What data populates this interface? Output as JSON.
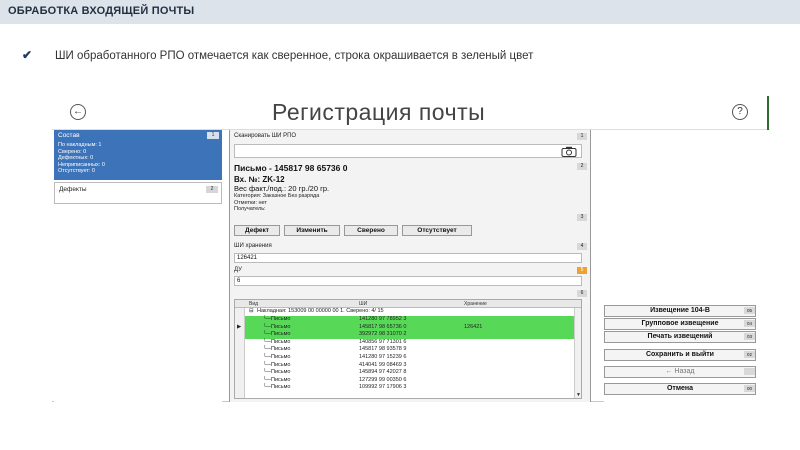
{
  "slide": {
    "header": "ОБРАБОТКА ВХОДЯЩЕЙ ПОЧТЫ",
    "bullet_mark": "✔",
    "bullet_text": "ШИ обработанного РПО отмечается как сверенное, строка окрашивается в зеленый цвет"
  },
  "app": {
    "title": "Регистрация почты",
    "back_glyph": "←",
    "help_glyph": "?",
    "sostav": {
      "title": "Состав",
      "badge": "1",
      "lines": [
        "По накладным: 1",
        "Сверено: 0",
        "Дефектных: 0",
        "Неприписанных: 0",
        "Отсутствует: 0"
      ]
    },
    "defects": {
      "title": "Дефекты",
      "badge": "2"
    },
    "scan": {
      "label": "Сканировать ШИ РПО",
      "badge": "1"
    },
    "item": {
      "badge": "2",
      "title": "Письмо - 145817 98 65736 0",
      "vx": "Вх. №: ZK-12",
      "weight": "Вес факт./под.: 20 гр./20 гр.",
      "lines": [
        "Категория: Заказное Без разряда",
        "Отметки: нет",
        "Получатель:"
      ]
    },
    "actions_badge": "3",
    "actions": [
      "Дефект",
      "Изменить",
      "Сверено",
      "Отсутствует"
    ],
    "storage": {
      "label": "ШИ хранения",
      "badge": "4",
      "value": "126421"
    },
    "du": {
      "label": "ДУ",
      "badge": "5",
      "value": "6"
    },
    "grid_badge": "6",
    "grid": {
      "columns": [
        "Вид",
        "ШИ",
        "Хранение"
      ],
      "group": "Накладная: 153009 00 00000 00 1. Сверено: 4/ 15",
      "rows": [
        {
          "type": "Письмо",
          "id": "141280 97 78952 3",
          "storage": "",
          "green": true,
          "current": false
        },
        {
          "type": "Письмо",
          "id": "145817 98 65736 0",
          "storage": "126421",
          "green": true,
          "current": true
        },
        {
          "type": "Письмо",
          "id": "392972 98 31070 2",
          "storage": "",
          "green": true,
          "current": false
        },
        {
          "type": "Письмо",
          "id": "140856 97 71301 6",
          "storage": "",
          "green": false,
          "current": false
        },
        {
          "type": "Письмо",
          "id": "145817 98 93578 9",
          "storage": "",
          "green": false,
          "current": false
        },
        {
          "type": "Письмо",
          "id": "141280 97 15239 6",
          "storage": "",
          "green": false,
          "current": false
        },
        {
          "type": "Письмо",
          "id": "414041 99 08469 3",
          "storage": "",
          "green": false,
          "current": false
        },
        {
          "type": "Письмо",
          "id": "145894 97 42027 8",
          "storage": "",
          "green": false,
          "current": false
        },
        {
          "type": "Письмо",
          "id": "127299 99 00350 6",
          "storage": "",
          "green": false,
          "current": false
        },
        {
          "type": "Письмо",
          "id": "109992 97 17906 3",
          "storage": "",
          "green": false,
          "current": false
        }
      ]
    },
    "side_buttons": [
      {
        "label": "Извещение 104-В",
        "badge": "05",
        "disabled": false
      },
      {
        "label": "Групповое извещение",
        "badge": "04",
        "disabled": false
      },
      {
        "label": "Печать извещений",
        "badge": "03",
        "disabled": false
      },
      {
        "label": "Сохранить и выйти",
        "badge": "02",
        "disabled": false
      },
      {
        "label": "← Назад",
        "badge": "",
        "disabled": true
      },
      {
        "label": "Отмена",
        "badge": "00",
        "disabled": false
      }
    ]
  }
}
